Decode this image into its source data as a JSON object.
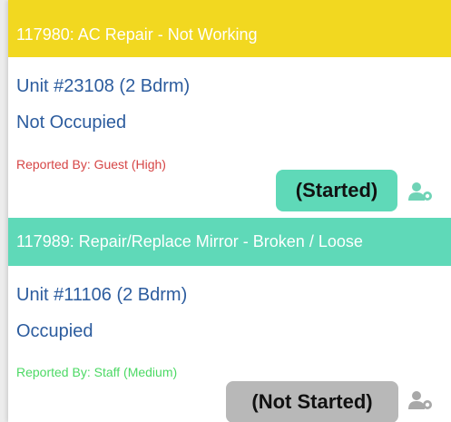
{
  "work_orders": [
    {
      "header": "117980:  AC Repair - Not Working",
      "header_color": "#f2d820",
      "unit": "Unit #23108 (2 Bdrm)",
      "occupancy": "Not Occupied",
      "reported": "Reported By: Guest  (High)",
      "reported_color": "#d64545",
      "status": "(Started)",
      "status_color": "#5fd9b8",
      "icon": "person-assign-icon",
      "icon_color": "#6fd3b6"
    },
    {
      "header": "117989:  Repair/Replace Mirror - Broken / Loose",
      "header_color": "#5fd9b8",
      "unit": "Unit #11106 (2 Bdrm)",
      "occupancy": "Occupied",
      "reported": "Reported By: Staff  (Medium)",
      "reported_color": "#4cd964",
      "status": "(Not Started)",
      "status_color": "#b8b8b8",
      "icon": "person-assign-icon",
      "icon_color": "#a8a8a8"
    }
  ]
}
